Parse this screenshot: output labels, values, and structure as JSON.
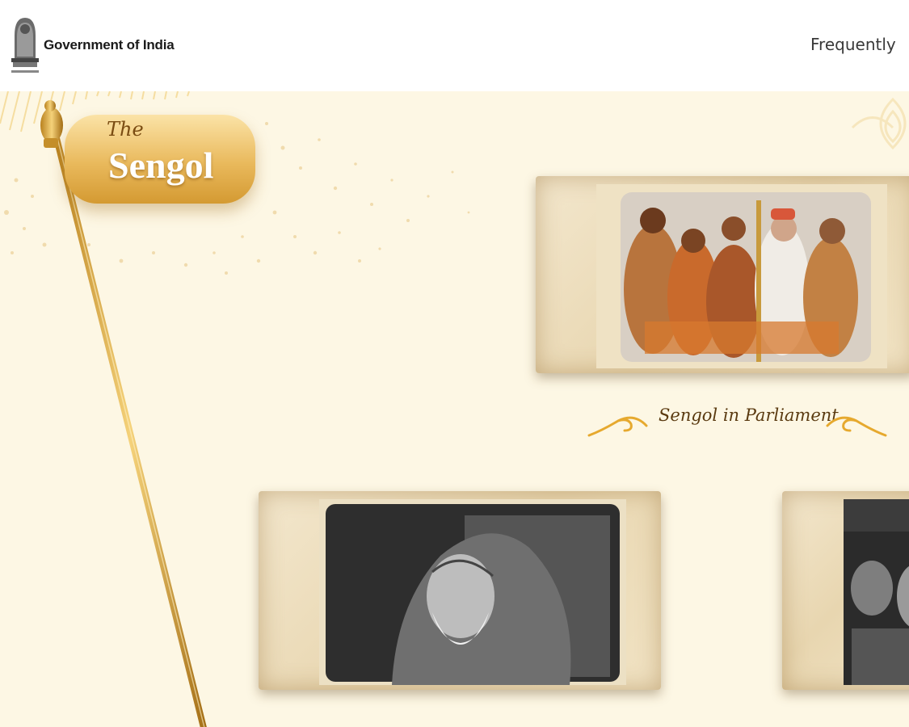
{
  "header": {
    "gov_label": "Government of India",
    "nav_link_faq": "Frequently"
  },
  "hero": {
    "badge_small": "The",
    "badge_main": "Sengol"
  },
  "cards": [
    {
      "caption": "Sengol in Parliament",
      "photo": "sengol-handover-photo"
    },
    {
      "caption": "",
      "photo": "elderly-saint-portrait"
    },
    {
      "caption": "",
      "photo": "historic-bw-photo"
    }
  ],
  "colors": {
    "accent_gold": "#e2a93c",
    "background": "#fdf7e4",
    "header_bg": "#ffffff"
  }
}
